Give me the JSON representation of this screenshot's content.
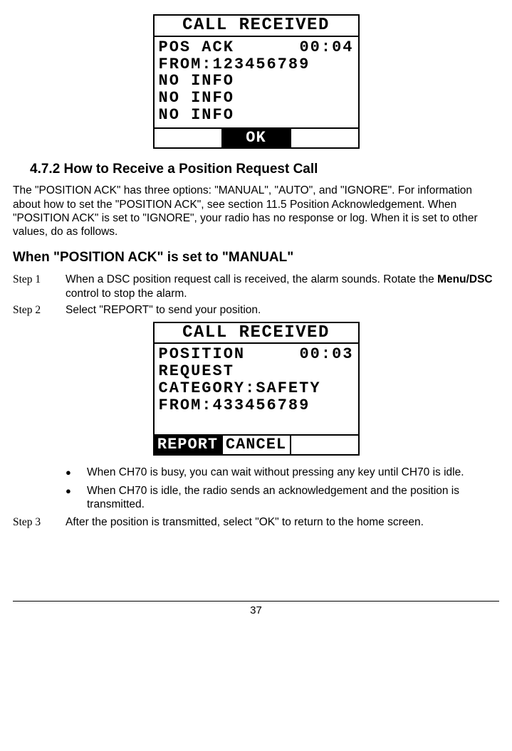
{
  "lcd1": {
    "header": "CALL RECEIVED",
    "line1_left": "POS ACK",
    "line1_right": "00:04",
    "line2": "FROM:123456789",
    "line3": "NO INFO",
    "line4": "NO INFO",
    "line5": "NO INFO",
    "soft_left": "",
    "soft_mid": "OK",
    "soft_right": ""
  },
  "section_number": "4.7.2",
  "section_title": "How to Receive a Position Request Call",
  "intro_text": "The \"POSITION ACK\" has three options: \"MANUAL\", \"AUTO\", and \"IGNORE\". For information about how to set the \"POSITION ACK\", see section 11.5 Position Acknowledgement. When \"POSITION ACK\" is set to \"IGNORE\", your radio has no response or log. When it is set to other values, do as follows.",
  "sub_heading": "When \"POSITION ACK\" is set to \"MANUAL\"",
  "step1_label": "Step 1",
  "step1_text_a": "When a DSC position request call is received, the alarm sounds. Rotate the ",
  "step1_bold": "Menu/DSC",
  "step1_text_b": " control to stop the alarm.",
  "step2_label": "Step 2",
  "step2_text": "Select \"REPORT\" to send your position.",
  "lcd2": {
    "header": "CALL RECEIVED",
    "line1_left": "POSITION",
    "line1_right": "00:03",
    "line2": "REQUEST",
    "line3": "CATEGORY:SAFETY",
    "line4": "FROM:433456789",
    "soft_left": "REPORT",
    "soft_mid": "CANCEL",
    "soft_right": ""
  },
  "bullet1": "When CH70 is busy, you can wait without pressing any key until CH70 is idle.",
  "bullet2": "When CH70 is idle, the radio sends an acknowledgement and the position is transmitted.",
  "step3_label": "Step 3",
  "step3_text": "After the position is transmitted, select \"OK\" to return to the home screen.",
  "page_number": "37"
}
